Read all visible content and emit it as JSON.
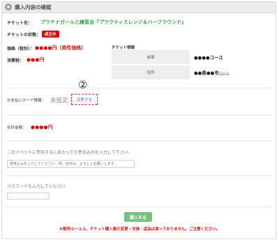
{
  "header": {
    "title": "購入内容の確認"
  },
  "ticket": {
    "name_label": "チケット名：",
    "name_value": "プラチナガールと練習会『プラクティスレンジ＆ハーフラウンド』",
    "status_label": "チケットの状態：",
    "status_badge": "成立中",
    "price_label": "価格（税別）：",
    "price_value": "●●●●円（男性価格）",
    "tax_label": "消費税：",
    "tax_value": "●●●円"
  },
  "ticket_info": {
    "title": "チケット情報",
    "rows": [
      {
        "key": "会場",
        "value": "●●●●コース"
      },
      {
        "key": "住所",
        "value": "●●県●●市△△△"
      }
    ]
  },
  "payment": {
    "label": "お支払いカード情報：",
    "status": "未設定",
    "change_button": "変更する",
    "annotation": "②"
  },
  "total": {
    "label": "合計金額：",
    "value": "●●●●円"
  },
  "message": {
    "label": "このイベントに参加するにあたっての意気込みを入力して下さい。",
    "placeholder": "意気込みを入力してください。例、初日は、よろしくお願いします。"
  },
  "password": {
    "label": "パスワードを入力してください",
    "value": ""
  },
  "submit": {
    "label": "購入する"
  },
  "notice": "※販売ルール上、チケット購入後の変更・交換・返品は承っておりません。ご注意ください。"
}
